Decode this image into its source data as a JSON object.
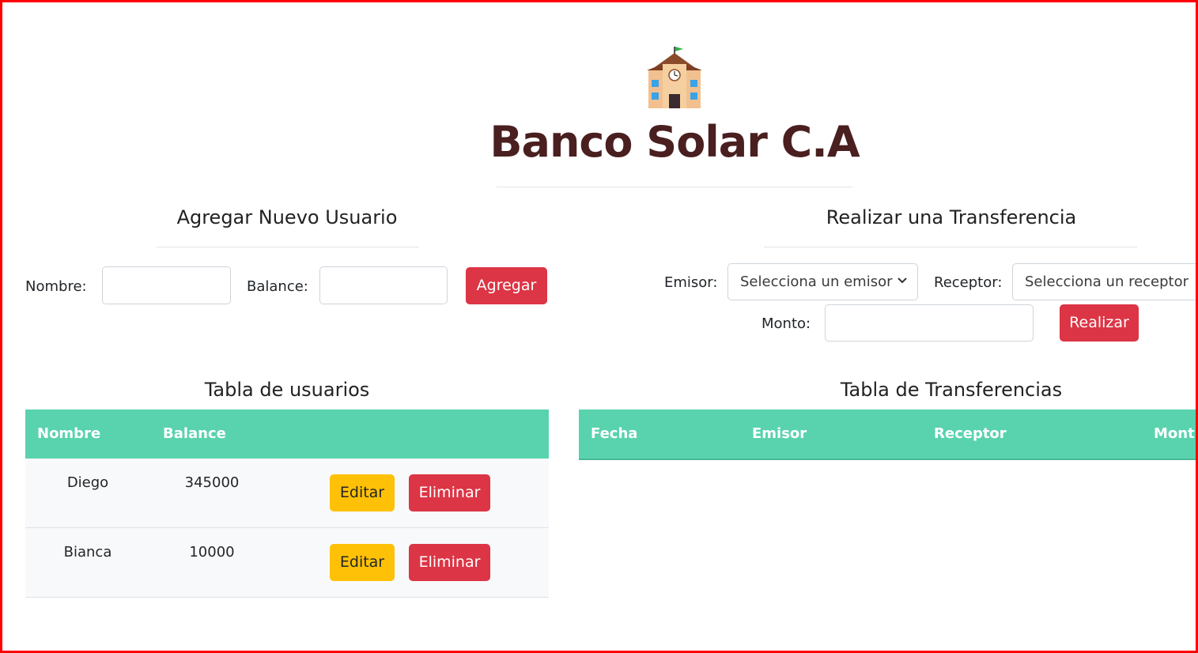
{
  "header": {
    "logo_icon": "school-building-icon",
    "title": "Banco Solar C.A"
  },
  "add_user": {
    "heading": "Agregar Nuevo Usuario",
    "name_label": "Nombre:",
    "name_value": "",
    "balance_label": "Balance:",
    "balance_value": "",
    "submit_label": "Agregar"
  },
  "transfer": {
    "heading": "Realizar una Transferencia",
    "sender_label": "Emisor:",
    "sender_selected": "Selecciona un emisor",
    "receiver_label": "Receptor:",
    "receiver_selected": "Selecciona un receptor",
    "amount_label": "Monto:",
    "amount_value": "",
    "submit_label": "Realizar"
  },
  "users_table": {
    "heading": "Tabla de usuarios",
    "columns": [
      "Nombre",
      "Balance",
      ""
    ],
    "rows": [
      {
        "name": "Diego",
        "balance": "345000",
        "edit_label": "Editar",
        "delete_label": "Eliminar"
      },
      {
        "name": "Bianca",
        "balance": "10000",
        "edit_label": "Editar",
        "delete_label": "Eliminar"
      }
    ]
  },
  "transfers_table": {
    "heading": "Tabla de Transferencias",
    "columns": [
      "Fecha",
      "Emisor",
      "Receptor",
      "Mont"
    ],
    "rows": []
  },
  "colors": {
    "frame": "#ff0000",
    "title": "#4a1f1f",
    "table_header": "#59d3ae",
    "danger": "#dc3545",
    "warning": "#ffc107"
  }
}
